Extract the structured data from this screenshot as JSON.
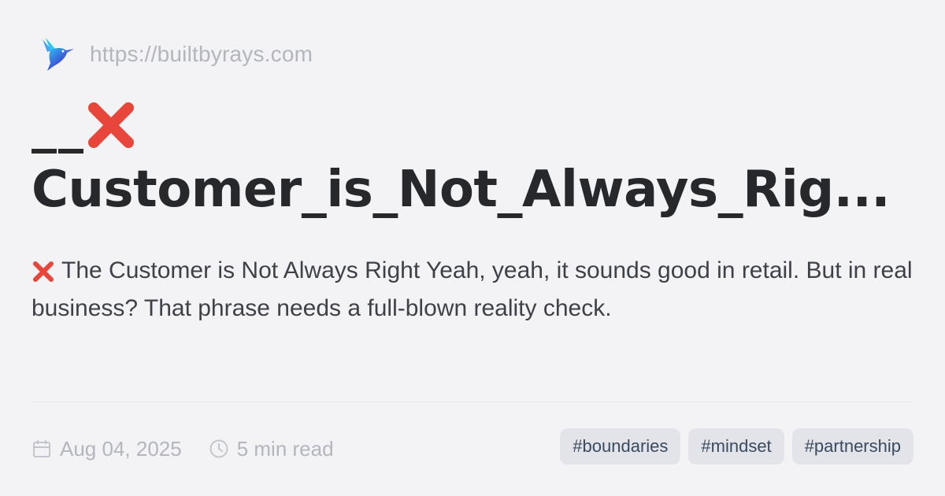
{
  "site": {
    "url": "https://builtbyrays.com",
    "logo_icon": "hummingbird-icon"
  },
  "title": {
    "line1_prefix": "__",
    "line1_icon": "cross-mark-icon",
    "line2": "Customer_is_Not_Always_Rig..."
  },
  "description": {
    "icon": "cross-mark-icon",
    "text": "The Customer is Not Always Right Yeah, yeah, it sounds good in retail. But in real business? That phrase needs a full-blown reality check."
  },
  "meta": {
    "date": "Aug 04, 2025",
    "date_icon": "calendar-icon",
    "read_time": "5 min read",
    "read_time_icon": "clock-icon"
  },
  "tags": [
    "#boundaries",
    "#mindset",
    "#partnership"
  ],
  "colors": {
    "background": "#f3f3f6",
    "title": "#27282b",
    "muted": "#b3b6bd",
    "cross": "#e8463a",
    "tag_bg": "#e2e4e9",
    "tag_text": "#3a4a5f"
  }
}
